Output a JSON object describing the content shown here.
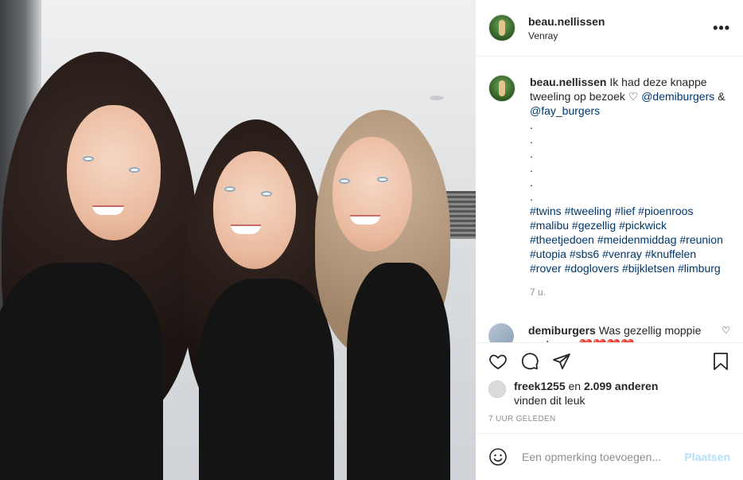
{
  "post": {
    "username": "beau.nellissen",
    "location": "Venray",
    "more": "•••",
    "caption": {
      "username": "beau.nellissen",
      "text": "Ik had deze knappe tweeling op bezoek ♡",
      "mention1": "@demiburgers",
      "amp": "&",
      "mention2": "@fay_burgers",
      "dots": [
        ".",
        ".",
        ".",
        ".",
        ".",
        "."
      ],
      "hashtags": "#twins #tweeling #lief #pioenroos #malibu #gezellig #pickwick #theetjedoen #meidenmiddag #reunion #utopia #sbs6 #venray #knuffelen #rover #doglovers #bijkletsen #limburg",
      "time": "7 u."
    },
    "reply": {
      "username": "demiburgers",
      "text": "Was gezellig moppie snel weer ❤️❤️❤️❤️"
    },
    "likes": {
      "user": "freek1255",
      "connector": "en",
      "count": "2.099 anderen",
      "suffix": "vinden dit leuk"
    },
    "ago": "7 UUR GELEDEN",
    "comment_input": {
      "placeholder": "Een opmerking toevoegen..."
    },
    "post_button": "Plaatsen"
  },
  "icons": [
    "heart-icon",
    "comment-icon",
    "share-icon",
    "bookmark-icon",
    "emoji-icon",
    "more-icon"
  ]
}
